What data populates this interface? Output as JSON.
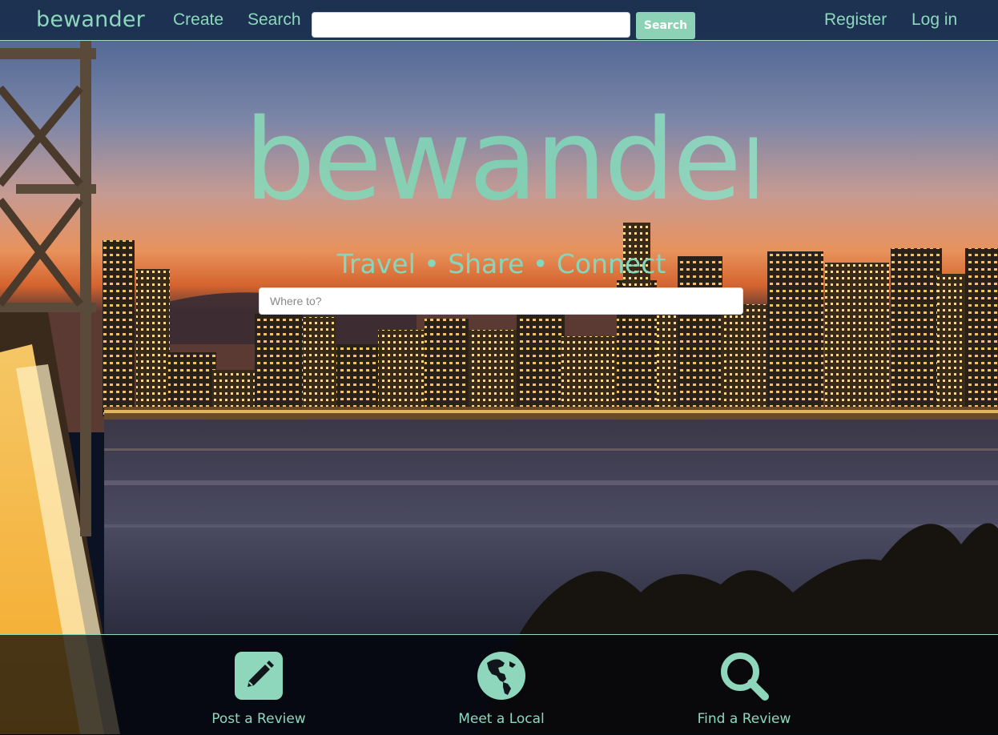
{
  "navbar": {
    "brand": "bewander",
    "links": {
      "create": "Create",
      "search": "Search",
      "register": "Register",
      "login": "Log in"
    },
    "search_input_value": "",
    "search_button": "Search"
  },
  "hero": {
    "logo_text": "bewander",
    "tagline": "Travel • Share • Connect",
    "search_placeholder": "Where to?",
    "search_value": ""
  },
  "features": [
    {
      "label": "Post a Review",
      "icon": "pencil-square-icon"
    },
    {
      "label": "Meet a Local",
      "icon": "globe-americas-icon"
    },
    {
      "label": "Find a Review",
      "icon": "magnifier-icon"
    }
  ],
  "colors": {
    "accent": "#8dd8bd",
    "navbar_bg": "#1b2f4e",
    "button_bg": "#8dd1b6"
  }
}
